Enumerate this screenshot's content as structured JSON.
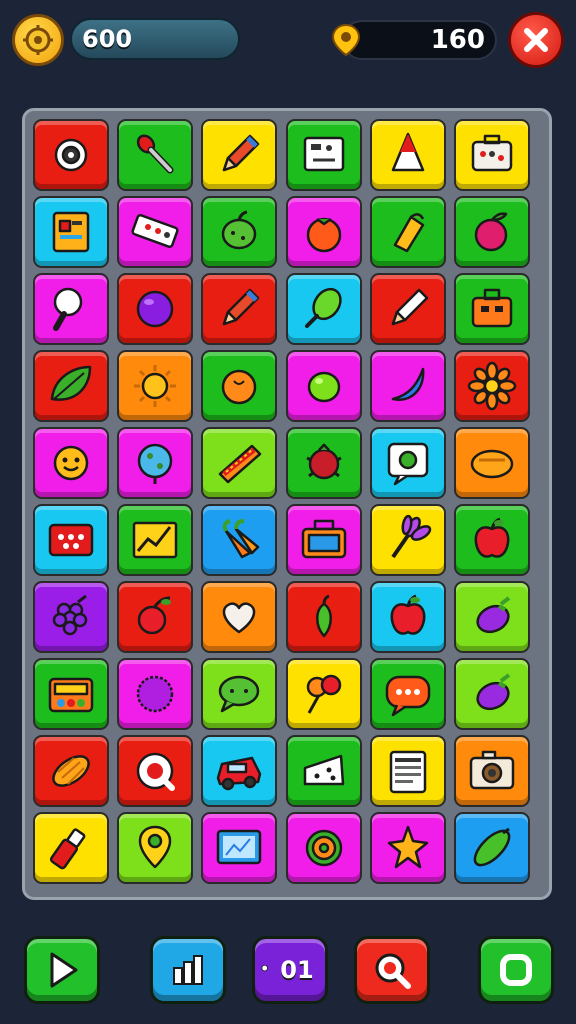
{
  "header": {
    "score": "600",
    "coins": "160"
  },
  "board": {
    "rows": 10,
    "cols": 6,
    "tiles": [
      {
        "color": "red",
        "icon": "gear-bug-icon"
      },
      {
        "color": "green",
        "icon": "spoon-icon"
      },
      {
        "color": "yellow",
        "icon": "pencil-icon"
      },
      {
        "color": "green",
        "icon": "calculator-icon"
      },
      {
        "color": "yellow",
        "icon": "traffic-cone-icon"
      },
      {
        "color": "yellow",
        "icon": "first-aid-box-icon"
      },
      {
        "color": "cyan",
        "icon": "notebook-icon"
      },
      {
        "color": "magenta",
        "icon": "eraser-icon"
      },
      {
        "color": "green",
        "icon": "green-pepper-icon"
      },
      {
        "color": "magenta",
        "icon": "tomato-icon"
      },
      {
        "color": "green",
        "icon": "corn-icon"
      },
      {
        "color": "green",
        "icon": "plum-icon"
      },
      {
        "color": "magenta",
        "icon": "magnifier-icon"
      },
      {
        "color": "red",
        "icon": "purple-ball-icon"
      },
      {
        "color": "red",
        "icon": "pencil-icon"
      },
      {
        "color": "cyan",
        "icon": "leaf-pod-icon"
      },
      {
        "color": "red",
        "icon": "pen-icon"
      },
      {
        "color": "green",
        "icon": "toolbox-icon"
      },
      {
        "color": "red",
        "icon": "leaf-icon"
      },
      {
        "color": "orange",
        "icon": "sun-icon"
      },
      {
        "color": "green",
        "icon": "orange-fruit-icon"
      },
      {
        "color": "magenta",
        "icon": "lime-fruit-icon"
      },
      {
        "color": "magenta",
        "icon": "blue-drop-icon"
      },
      {
        "color": "red",
        "icon": "flower-icon"
      },
      {
        "color": "magenta",
        "icon": "smiley-icon"
      },
      {
        "color": "magenta",
        "icon": "globe-icon"
      },
      {
        "color": "lime",
        "icon": "hotdog-icon"
      },
      {
        "color": "green",
        "icon": "spiky-berry-icon"
      },
      {
        "color": "cyan",
        "icon": "chat-bubble-icon"
      },
      {
        "color": "orange",
        "icon": "bread-icon"
      },
      {
        "color": "cyan",
        "icon": "game-card-icon"
      },
      {
        "color": "green",
        "icon": "chart-icon"
      },
      {
        "color": "blue",
        "icon": "carrot-bunch-icon"
      },
      {
        "color": "magenta",
        "icon": "lunch-box-icon"
      },
      {
        "color": "yellow",
        "icon": "lavender-icon"
      },
      {
        "color": "green",
        "icon": "apple-icon"
      },
      {
        "color": "purple",
        "icon": "grape-icon"
      },
      {
        "color": "red",
        "icon": "cherry-icon"
      },
      {
        "color": "orange",
        "icon": "heart-bowl-icon"
      },
      {
        "color": "red",
        "icon": "pepper-icon"
      },
      {
        "color": "cyan",
        "icon": "apple-icon"
      },
      {
        "color": "lime",
        "icon": "eggplant-icon"
      },
      {
        "color": "green",
        "icon": "radio-icon"
      },
      {
        "color": "magenta",
        "icon": "fuzzy-ball-icon"
      },
      {
        "color": "lime",
        "icon": "speech-bubble-icon"
      },
      {
        "color": "yellow",
        "icon": "lollipop-icon"
      },
      {
        "color": "green",
        "icon": "message-icon"
      },
      {
        "color": "lime",
        "icon": "eggplant-icon"
      },
      {
        "color": "red",
        "icon": "croissant-icon"
      },
      {
        "color": "red",
        "icon": "search-bubble-icon"
      },
      {
        "color": "cyan",
        "icon": "car-icon"
      },
      {
        "color": "green",
        "icon": "cheese-icon"
      },
      {
        "color": "yellow",
        "icon": "clipboard-icon"
      },
      {
        "color": "orange",
        "icon": "camera-icon"
      },
      {
        "color": "yellow",
        "icon": "lipstick-icon"
      },
      {
        "color": "lime",
        "icon": "location-pin-icon"
      },
      {
        "color": "magenta",
        "icon": "monitor-icon"
      },
      {
        "color": "magenta",
        "icon": "target-icon"
      },
      {
        "color": "magenta",
        "icon": "star-icon"
      },
      {
        "color": "blue",
        "icon": "pickle-icon"
      }
    ]
  },
  "footer": {
    "buttons": [
      {
        "name": "play-button",
        "icon": "play-icon",
        "color": "green"
      },
      {
        "name": "stats-button",
        "icon": "bar-chart-icon",
        "color": "blue"
      },
      {
        "name": "counter-button",
        "icon": "counter-icon",
        "color": "purple",
        "label": "01"
      },
      {
        "name": "hint-button",
        "icon": "hint-icon",
        "color": "red"
      },
      {
        "name": "stop-button",
        "icon": "stop-icon",
        "color": "green"
      }
    ]
  }
}
